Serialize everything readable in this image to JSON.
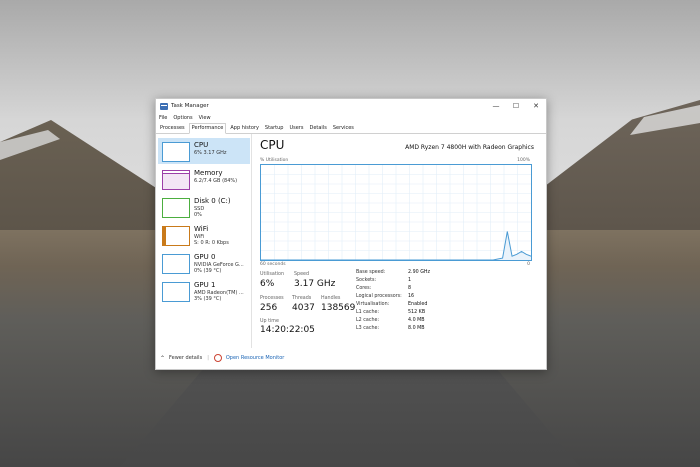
{
  "window": {
    "title": "Task Manager",
    "controls": {
      "minimize": "—",
      "maximize": "☐",
      "close": "✕"
    }
  },
  "menu": [
    "File",
    "Options",
    "View"
  ],
  "tabs": [
    {
      "label": "Processes"
    },
    {
      "label": "Performance",
      "active": true
    },
    {
      "label": "App history"
    },
    {
      "label": "Startup"
    },
    {
      "label": "Users"
    },
    {
      "label": "Details"
    },
    {
      "label": "Services"
    }
  ],
  "sidebar": {
    "items": [
      {
        "name": "CPU",
        "line1": "6% 3.17 GHz",
        "line2": "",
        "color": "#4a9bd4",
        "selected": true
      },
      {
        "name": "Memory",
        "line1": "6.2/7.4 GB (84%)",
        "line2": "",
        "color": "#9c3fa8"
      },
      {
        "name": "Disk 0 (C:)",
        "line1": "SSD",
        "line2": "0%",
        "color": "#4cae3f"
      },
      {
        "name": "WiFi",
        "line1": "WiFi",
        "line2": "S: 0 R: 0 Kbps",
        "color": "#c97a1a"
      },
      {
        "name": "GPU 0",
        "line1": "NVIDIA GeForce G...",
        "line2": "0% (39 °C)",
        "color": "#4a9bd4"
      },
      {
        "name": "GPU 1",
        "line1": "AMD Radeon(TM) ...",
        "line2": "3% (39 °C)",
        "color": "#4a9bd4"
      }
    ]
  },
  "main": {
    "title": "CPU",
    "model": "AMD Ryzen 7 4800H with Radeon Graphics",
    "util_label": "% Utilisation",
    "max_label": "100%",
    "time_label": "60 seconds",
    "zero_label": "0",
    "graph": {
      "line_color": "#4a9bd4",
      "values": [
        0,
        0,
        0,
        0,
        0,
        0,
        0,
        0,
        0,
        0,
        0,
        0,
        0,
        0,
        0,
        0,
        0,
        0,
        0,
        0,
        0,
        0,
        0,
        0,
        0,
        0,
        0,
        0,
        0,
        0,
        0,
        0,
        0,
        0,
        0,
        0,
        0,
        0,
        0,
        0,
        0,
        0,
        0,
        0,
        0,
        0,
        0,
        0,
        0,
        0,
        1,
        2,
        30,
        4,
        6,
        9,
        6,
        4
      ]
    },
    "stats": {
      "utilisation_label": "Utilisation",
      "utilisation": "6%",
      "speed_label": "Speed",
      "speed": "3.17 GHz",
      "processes_label": "Processes",
      "processes": "256",
      "threads_label": "Threads",
      "threads": "4037",
      "handles_label": "Handles",
      "handles": "138569",
      "uptime_label": "Up time",
      "uptime": "14:20:22:05"
    },
    "details": [
      {
        "label": "Base speed:",
        "value": "2.90 GHz"
      },
      {
        "label": "Sockets:",
        "value": "1"
      },
      {
        "label": "Cores:",
        "value": "8"
      },
      {
        "label": "Logical processors:",
        "value": "16"
      },
      {
        "label": "Virtualisation:",
        "value": "Enabled"
      },
      {
        "label": "L1 cache:",
        "value": "512 KB"
      },
      {
        "label": "L2 cache:",
        "value": "4.0 MB"
      },
      {
        "label": "L3 cache:",
        "value": "8.0 MB"
      }
    ]
  },
  "footer": {
    "fewer_details": "Fewer details",
    "open_monitor": "Open Resource Monitor"
  }
}
